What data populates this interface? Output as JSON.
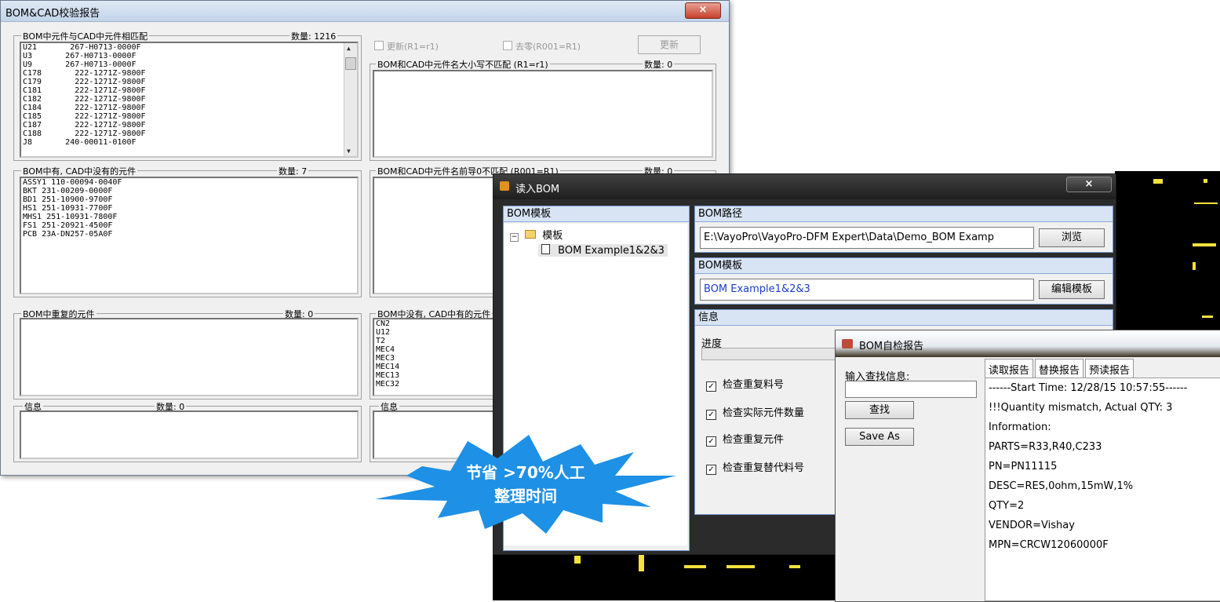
{
  "win1": {
    "title": "BOM&CAD校验报告",
    "close": "×",
    "matched": {
      "label": "BOM中元件与CAD中元件相匹配",
      "count": "数量: 1216",
      "rows": [
        "U21       267-H0713-0000F",
        "U3       267-H0713-0000F",
        "U9       267-H0713-0000F",
        "C178       222-1271Z-9800F",
        "C179       222-1271Z-9800F",
        "C181       222-1271Z-9800F",
        "C182       222-1271Z-9800F",
        "C184       222-1271Z-9800F",
        "C185       222-1271Z-9800F",
        "C187       222-1271Z-9800F",
        "C188       222-1271Z-9800F",
        "J8       240-00011-0100F"
      ]
    },
    "update_check": "更新(R1=r1)",
    "zero_check": "去零(R001=R1)",
    "update_button": "更新",
    "case_mismatch": {
      "label": "BOM和CAD中元件名大小写不匹配 (R1=r1)",
      "count": "数量: 0"
    },
    "zero_mismatch": {
      "label": "BOM和CAD中元件名前导0不匹配 (R001=R1)",
      "count": "数量: 0"
    },
    "bom_only": {
      "label": "BOM中有, CAD中没有的元件",
      "count": "数量: 7",
      "rows": [
        "ASSY1 110-00094-0040F",
        "BKT 231-00209-0000F",
        "BD1 251-10900-9700F",
        "HS1 251-10931-7700F",
        "MHS1 251-10931-7800F",
        "FS1 251-20921-4500F",
        "PCB 23A-DN257-05A0F"
      ]
    },
    "dup": {
      "label": "BOM中重复的元件",
      "count": "数量: 0"
    },
    "cad_only": {
      "label": "BOM中没有, CAD中有的元件",
      "rows": [
        "CN2",
        "U12",
        "T2",
        "MEC4",
        "MEC3",
        "MEC14",
        "MEC13",
        "MEC32"
      ]
    },
    "info_left": {
      "label": "信息",
      "count": "数量: 0"
    },
    "info_right": {
      "label": "信息"
    }
  },
  "win2": {
    "title": "读入BOM",
    "close": "×",
    "template_header": "BOM模板",
    "tree_root": "模板",
    "tree_child": "BOM Example1&2&3",
    "path_header": "BOM路径",
    "path_value": "E:\\VayoPro\\VayoPro-DFM Expert\\Data\\Demo_BOM Examp",
    "browse_button": "浏览",
    "tpl_header": "BOM模板",
    "tpl_value": "BOM Example1&2&3",
    "edit_button": "编辑模板",
    "info_header": "信息",
    "progress_label": "进度",
    "checks": [
      "检查重复料号",
      "检查实际元件数量",
      "检查重复元件",
      "检查重复替代料号"
    ]
  },
  "win3": {
    "title": "BOM自检报告",
    "search_label": "输入查找信息:",
    "search_value": "",
    "find_button": "查找",
    "saveas_button": "Save As",
    "tabs": [
      "读取报告",
      "替换报告",
      "预读报告"
    ],
    "report_lines": [
      "------Start Time: 12/28/15 10:57:55------",
      "",
      "!!!Quantity mismatch, Actual QTY: 3",
      "Information:",
      " PARTS=R33,R40,C233",
      " PN=PN11115",
      " DESC=RES,0ohm,15mW,1%",
      " QTY=2",
      " VENDOR=Vishay",
      " MPN=CRCW12060000F"
    ]
  },
  "callout": {
    "line1": "节省 >70%人工",
    "line2": "整理时间",
    "color": "#1e90e6"
  }
}
